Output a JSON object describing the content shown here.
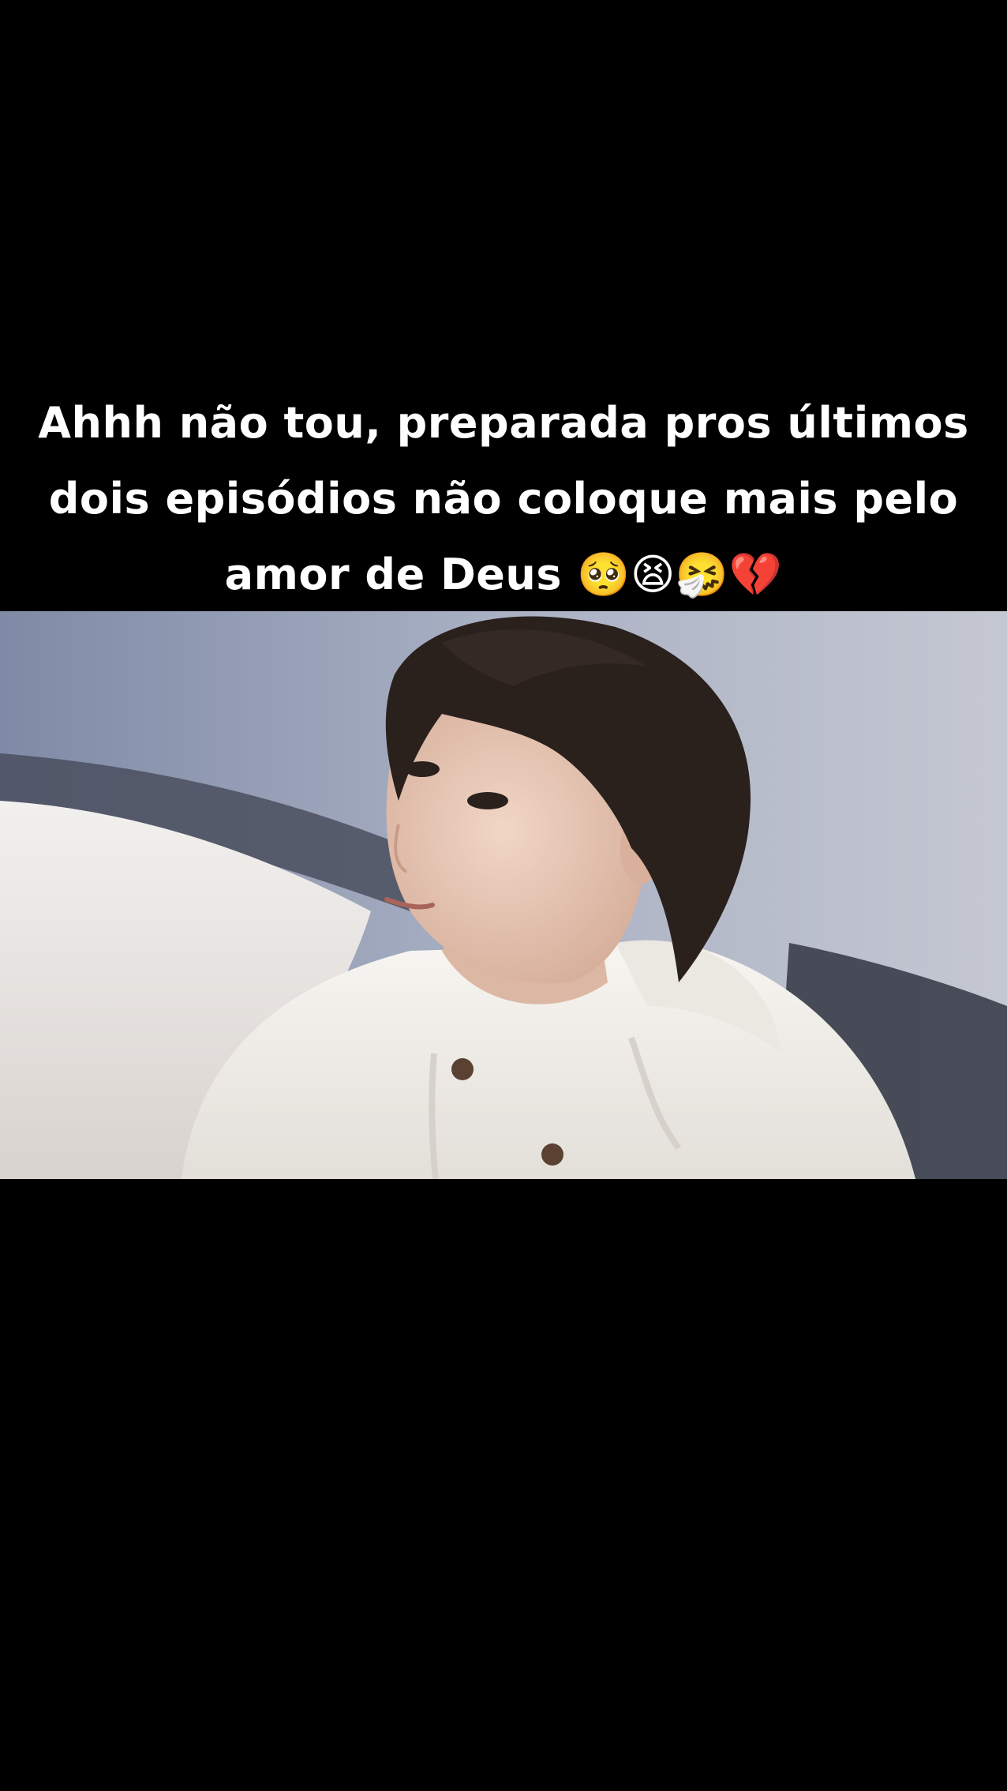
{
  "video": {
    "caption_lines": [
      "Ahhh não tou, preparada pros últimos",
      "dois episódios não coloque mais pelo",
      "amor de Deus 🥺😫🤧💔"
    ]
  },
  "frame": {
    "subject": "person-in-white-hoodie",
    "colors": {
      "wall": "#9ea6bc",
      "bed": "#e9e6e4",
      "hoodie": "#f3f0ec",
      "hair": "#2a211d",
      "skin": "#e8c9b6"
    }
  }
}
